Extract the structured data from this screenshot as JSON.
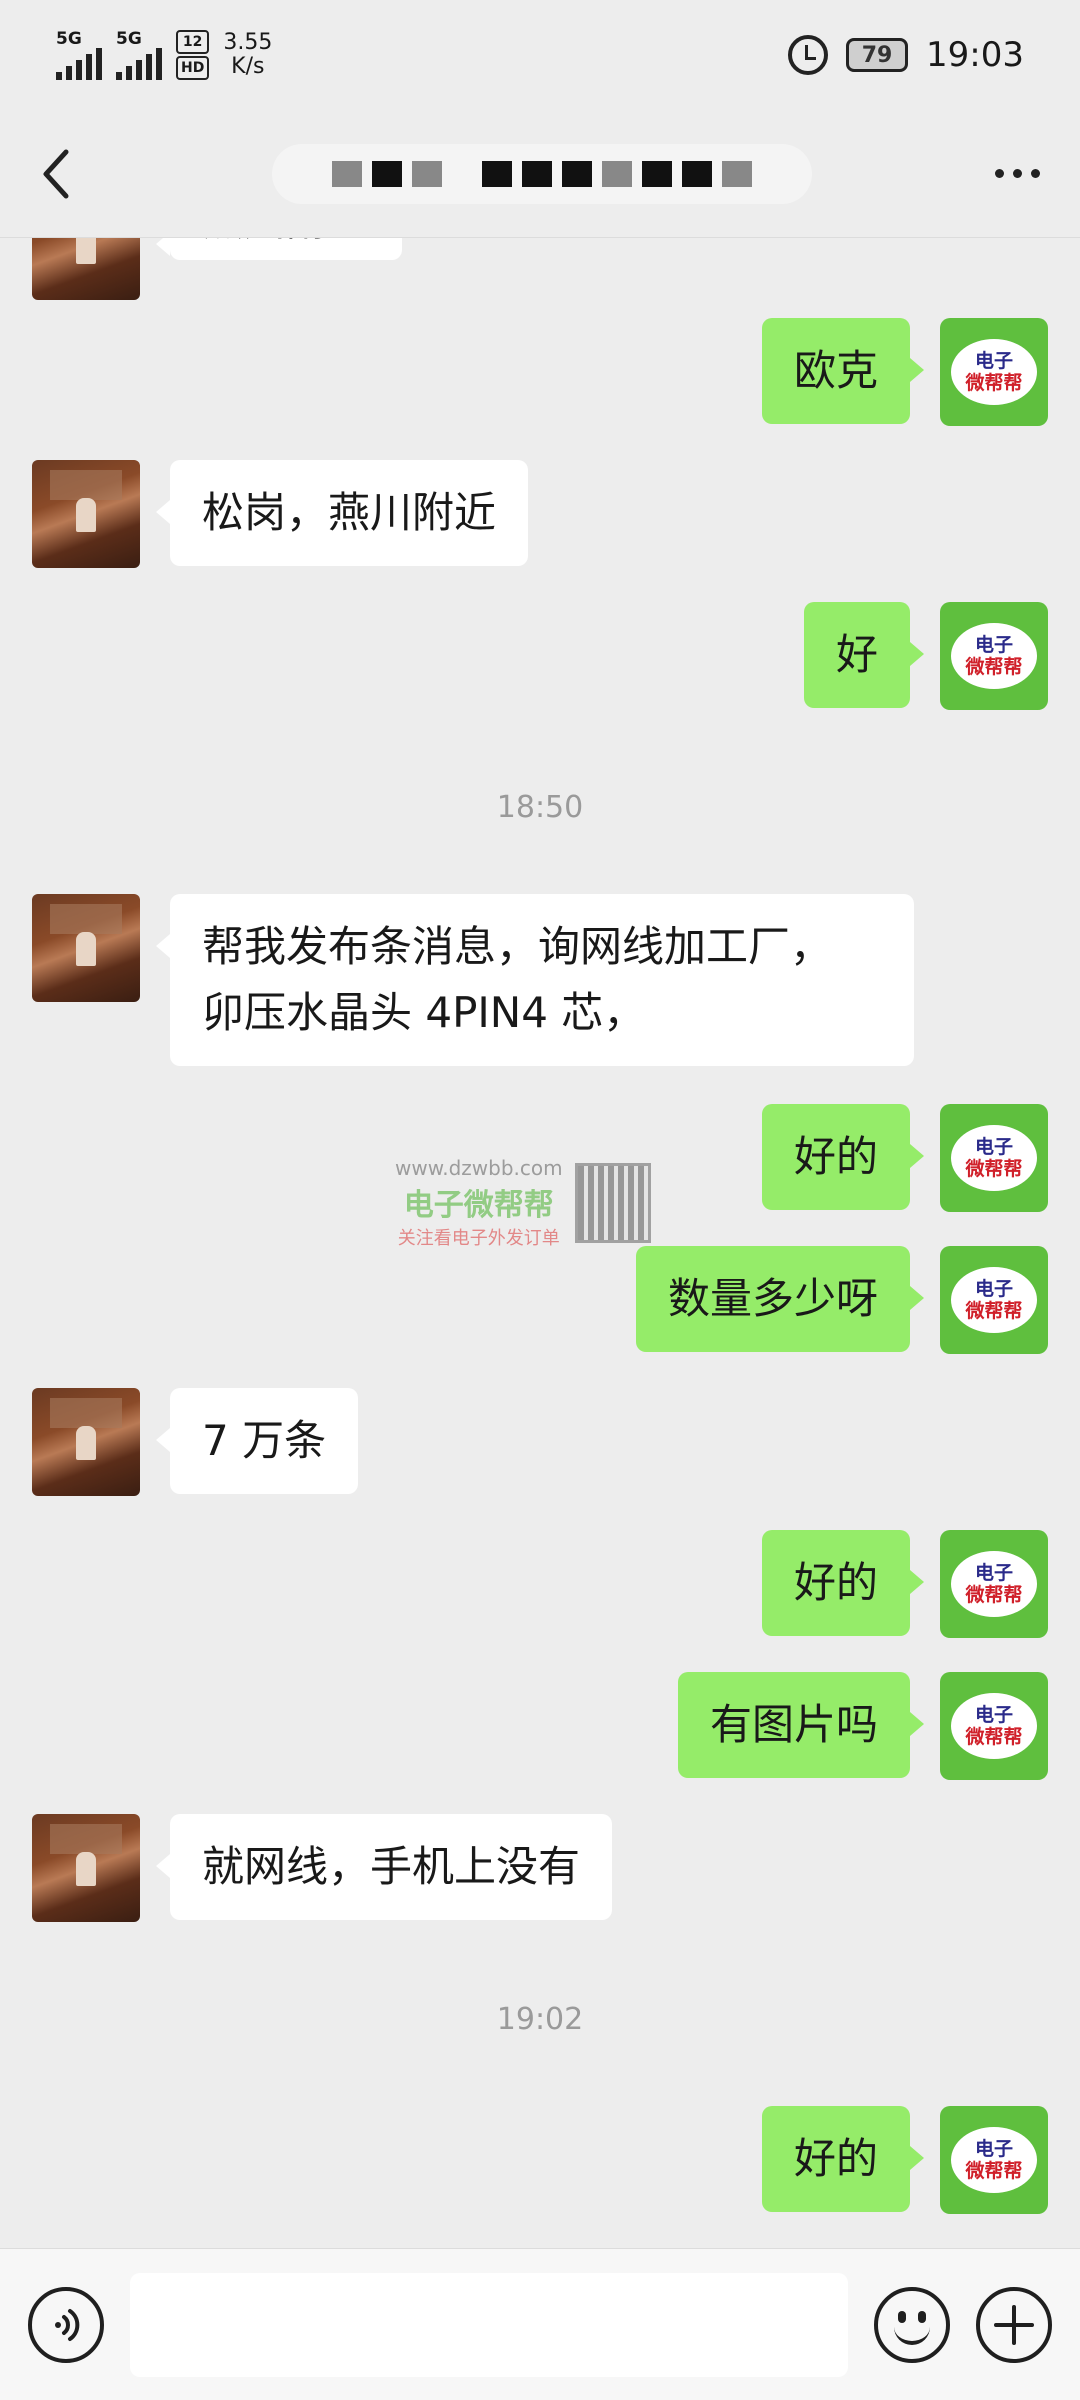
{
  "status_bar": {
    "signal1_label": "5G",
    "signal2_label": "5G",
    "hd_top": "12",
    "hd_bottom": "HD",
    "speed_value": "3.55",
    "speed_unit": "K/s",
    "battery": "79",
    "time": "19:03"
  },
  "header": {
    "title": ""
  },
  "messages": [
    {
      "side": "in",
      "text": "燕川附近",
      "partial": true
    },
    {
      "side": "out",
      "text": "欧克"
    },
    {
      "side": "in",
      "text": "松岗，燕川附近"
    },
    {
      "side": "out",
      "text": "好"
    },
    {
      "time": "18:50"
    },
    {
      "side": "in",
      "text": "帮我发布条消息，询网线加工厂，卯压水晶头 4PIN4 芯，",
      "line1": "帮我发布条消息，询网线加工厂，",
      "line2": "卯压水晶头 4PIN4 芯，"
    },
    {
      "side": "out",
      "text": "好的"
    },
    {
      "side": "out",
      "text": "数量多少呀"
    },
    {
      "side": "in",
      "text": "7 万条"
    },
    {
      "side": "out",
      "text": "好的"
    },
    {
      "side": "out",
      "text": "有图片吗"
    },
    {
      "side": "in",
      "text": "就网线，手机上没有"
    },
    {
      "time": "19:02"
    },
    {
      "side": "out",
      "text": "好的"
    }
  ],
  "avatar_out": {
    "line1": "电子",
    "line2": "微帮帮"
  },
  "watermark": {
    "url": "www.dzwbb.com",
    "name": "电子微帮帮",
    "sub": "关注看电子外发订单"
  },
  "input": {
    "value": "",
    "placeholder": ""
  },
  "colors": {
    "outgoing_bubble": "#95ec69",
    "incoming_bubble": "#ffffff",
    "background": "#ededed"
  },
  "icons": {
    "back": "chevron-left-icon",
    "more": "more-icon",
    "voice": "voice-icon",
    "emoji": "emoji-icon",
    "add": "plus-icon"
  }
}
